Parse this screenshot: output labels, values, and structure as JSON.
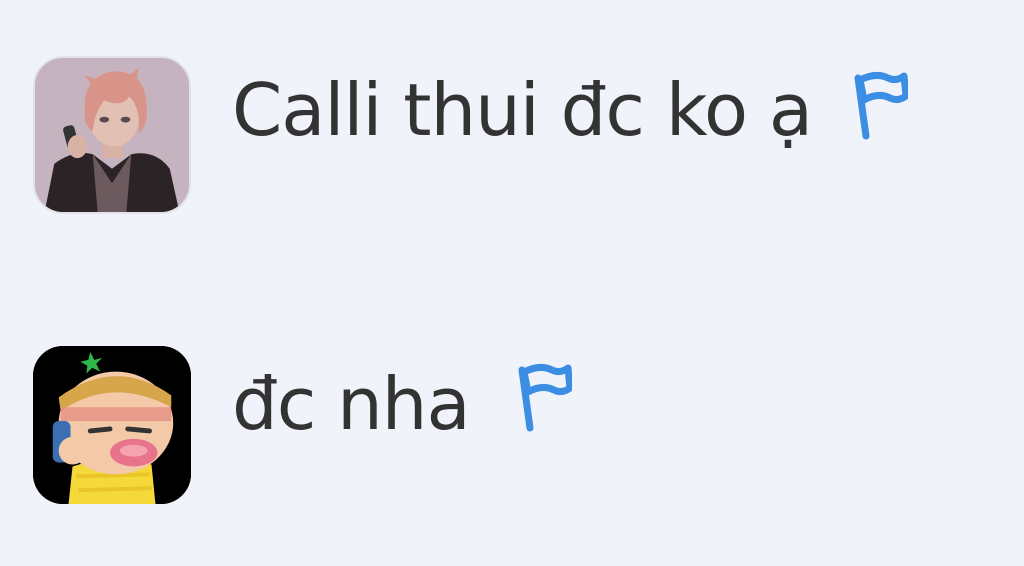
{
  "comments": [
    {
      "avatar_icon": "anime-boy-avatar-icon",
      "text": "Calli thui đc ko ạ",
      "flag_icon": "report-flag-icon"
    },
    {
      "avatar_icon": "cartoon-baby-avatar-icon",
      "text": "đc nha",
      "flag_icon": "report-flag-icon"
    }
  ],
  "colors": {
    "background": "#f0f3f9",
    "text": "#333333",
    "flag": "#3b8ee3"
  }
}
